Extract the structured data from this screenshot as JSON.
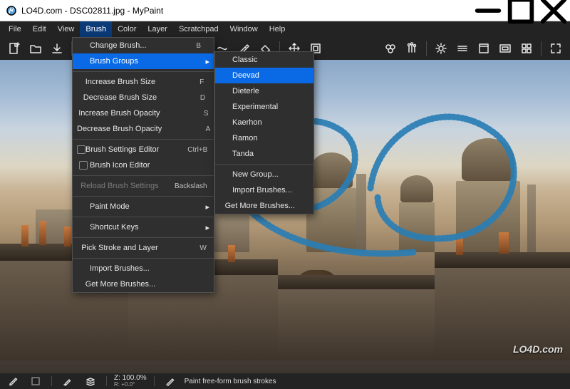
{
  "window": {
    "title": "LO4D.com - DSC02811.jpg - MyPaint"
  },
  "menubar": {
    "items": [
      "File",
      "Edit",
      "View",
      "Brush",
      "Color",
      "Layer",
      "Scratchpad",
      "Window",
      "Help"
    ],
    "open_index": 3
  },
  "brush_menu": {
    "items": [
      {
        "label": "Change Brush...",
        "accel": "B"
      },
      {
        "label": "Brush Groups",
        "submenu": true,
        "highlight": true
      },
      {
        "divider": true
      },
      {
        "label": "Increase Brush Size",
        "accel": "F"
      },
      {
        "label": "Decrease Brush Size",
        "accel": "D"
      },
      {
        "label": "Increase Brush Opacity",
        "accel": "S"
      },
      {
        "label": "Decrease Brush Opacity",
        "accel": "A"
      },
      {
        "divider": true
      },
      {
        "label": "Brush Settings Editor",
        "accel": "Ctrl+B",
        "checkbox": true
      },
      {
        "label": "Brush Icon Editor",
        "checkbox": true
      },
      {
        "divider": true
      },
      {
        "label": "Reload Brush Settings",
        "accel": "Backslash",
        "disabled": true
      },
      {
        "divider": true
      },
      {
        "label": "Paint Mode",
        "submenu": true
      },
      {
        "divider": true
      },
      {
        "label": "Shortcut Keys",
        "submenu": true
      },
      {
        "divider": true
      },
      {
        "label": "Pick Stroke and Layer",
        "accel": "W"
      },
      {
        "divider": true
      },
      {
        "label": "Import Brushes..."
      },
      {
        "label": "Get More Brushes..."
      }
    ]
  },
  "brush_groups_submenu": {
    "items": [
      {
        "label": "Classic"
      },
      {
        "label": "Deevad",
        "highlight": true
      },
      {
        "label": "Dieterle"
      },
      {
        "label": "Experimental"
      },
      {
        "label": "Kaerhon"
      },
      {
        "label": "Ramon"
      },
      {
        "label": "Tanda"
      },
      {
        "divider": true
      },
      {
        "label": "New Group..."
      },
      {
        "label": "Import Brushes..."
      },
      {
        "label": "Get More Brushes..."
      }
    ]
  },
  "statusbar": {
    "zoom_label": "Z: 100.0%",
    "rotation_label": "R: +0.0°",
    "hint": "Paint free-form brush strokes"
  },
  "watermark": "LO4D.com"
}
